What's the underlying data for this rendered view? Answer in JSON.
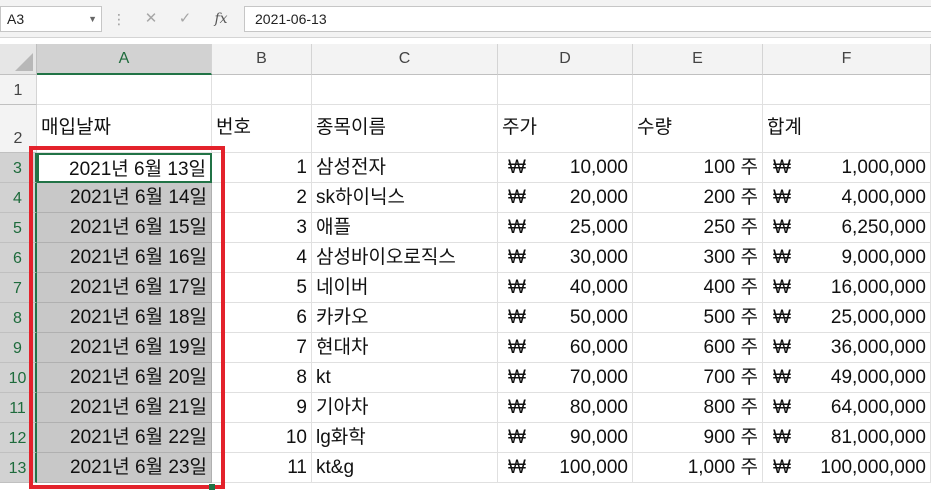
{
  "formula_bar": {
    "name_box": "A3",
    "cancel_icon": "✕",
    "enter_icon": "✓",
    "fx_label": "fx",
    "formula": "2021-06-13"
  },
  "columns": [
    "A",
    "B",
    "C",
    "D",
    "E",
    "F"
  ],
  "rows": [
    "1",
    "2",
    "3",
    "4",
    "5",
    "6",
    "7",
    "8",
    "9",
    "10",
    "11",
    "12",
    "13"
  ],
  "headers": {
    "date": "매입날짜",
    "number": "번호",
    "stock": "종목이름",
    "price": "주가",
    "quantity": "수량",
    "total": "합계"
  },
  "currency_symbol": "₩",
  "data_rows": [
    {
      "date": "2021년 6월 13일",
      "num": "1",
      "name": "삼성전자",
      "price": "10,000",
      "qty": "100 주",
      "total": "1,000,000"
    },
    {
      "date": "2021년 6월 14일",
      "num": "2",
      "name": "sk하이닉스",
      "price": "20,000",
      "qty": "200 주",
      "total": "4,000,000"
    },
    {
      "date": "2021년 6월 15일",
      "num": "3",
      "name": "애플",
      "price": "25,000",
      "qty": "250 주",
      "total": "6,250,000"
    },
    {
      "date": "2021년 6월 16일",
      "num": "4",
      "name": "삼성바이오로직스",
      "price": "30,000",
      "qty": "300 주",
      "total": "9,000,000"
    },
    {
      "date": "2021년 6월 17일",
      "num": "5",
      "name": "네이버",
      "price": "40,000",
      "qty": "400 주",
      "total": "16,000,000"
    },
    {
      "date": "2021년 6월 18일",
      "num": "6",
      "name": "카카오",
      "price": "50,000",
      "qty": "500 주",
      "total": "25,000,000"
    },
    {
      "date": "2021년 6월 19일",
      "num": "7",
      "name": "현대차",
      "price": "60,000",
      "qty": "600 주",
      "total": "36,000,000"
    },
    {
      "date": "2021년 6월 20일",
      "num": "8",
      "name": "kt",
      "price": "70,000",
      "qty": "700 주",
      "total": "49,000,000"
    },
    {
      "date": "2021년 6월 21일",
      "num": "9",
      "name": "기아차",
      "price": "80,000",
      "qty": "800 주",
      "total": "64,000,000"
    },
    {
      "date": "2021년 6월 22일",
      "num": "10",
      "name": "lg화학",
      "price": "90,000",
      "qty": "900 주",
      "total": "81,000,000"
    },
    {
      "date": "2021년 6월 23일",
      "num": "11",
      "name": "kt&g",
      "price": "100,000",
      "qty": "1,000 주",
      "total": "100,000,000"
    }
  ],
  "colors": {
    "selection_green": "#217346",
    "highlight_red": "#e3222b",
    "range_shade": "#c8c8c8"
  }
}
